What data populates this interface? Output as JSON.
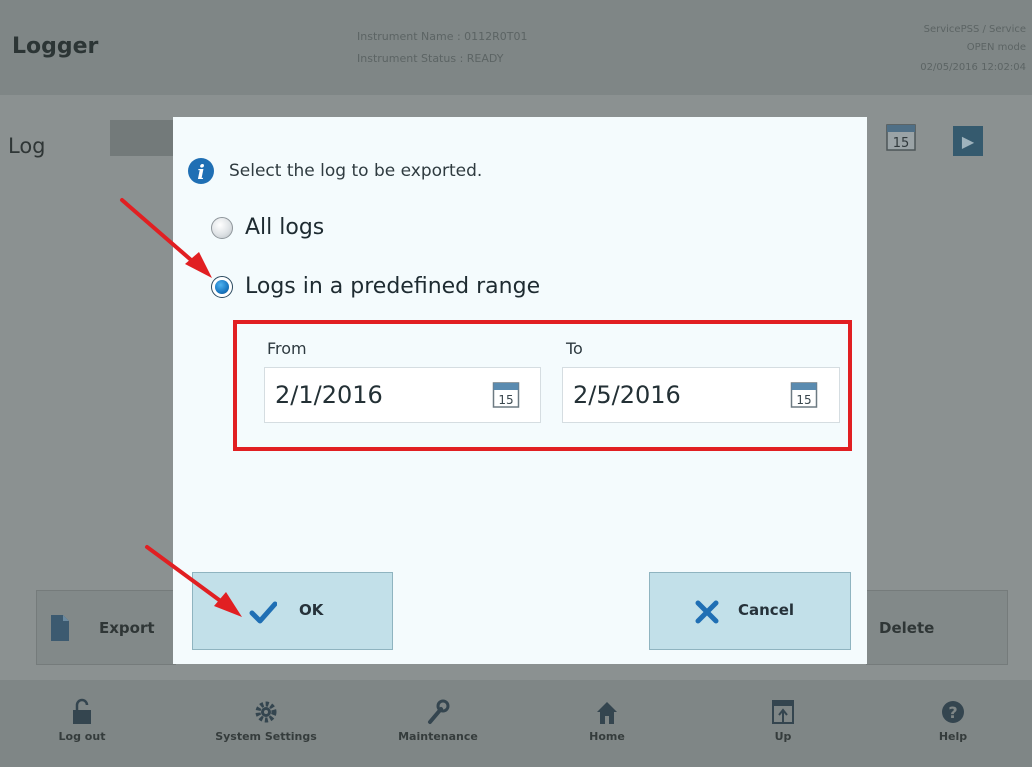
{
  "header": {
    "app_title": "Logger",
    "instrument_name": "Instrument Name : 0112R0T01",
    "instrument_status": "Instrument Status : READY",
    "user": "ServicePSS / Service",
    "mode": "OPEN mode",
    "datetime": "02/05/2016 12:02:04"
  },
  "log_panel": {
    "label": "Log",
    "calendar_day": "15"
  },
  "background_buttons": {
    "export": "Export",
    "delete": "Delete"
  },
  "nav": {
    "logout": "Log out",
    "system_settings": "System Settings",
    "maintenance": "Maintenance",
    "home": "Home",
    "up": "Up",
    "help": "Help"
  },
  "dialog": {
    "prompt": "Select the log to be exported.",
    "options": [
      {
        "label": "All logs",
        "selected": false
      },
      {
        "label": "Logs in a predefined range",
        "selected": true
      }
    ],
    "from_label": "From",
    "from_value": "2/1/2016",
    "to_label": "To",
    "to_value": "2/5/2016",
    "calendar_day": "15",
    "ok_label": "OK",
    "cancel_label": "Cancel"
  },
  "colors": {
    "dim_overlay": "#8b9191",
    "dialog_bg": "#f4fbfd",
    "button_bg": "#c2e0e9",
    "annotation_red": "#e11f22",
    "ok_check": "#1f6fb4",
    "cancel_x": "#1f6fb4"
  },
  "icons": [
    "info-icon",
    "radio-unchecked-icon",
    "radio-checked-icon",
    "calendar-icon",
    "checkmark-icon",
    "close-x-icon",
    "export-icon",
    "unlock-icon",
    "gear-icon",
    "wrench-icon",
    "home-icon",
    "up-window-icon",
    "help-icon",
    "next-arrow-icon"
  ]
}
